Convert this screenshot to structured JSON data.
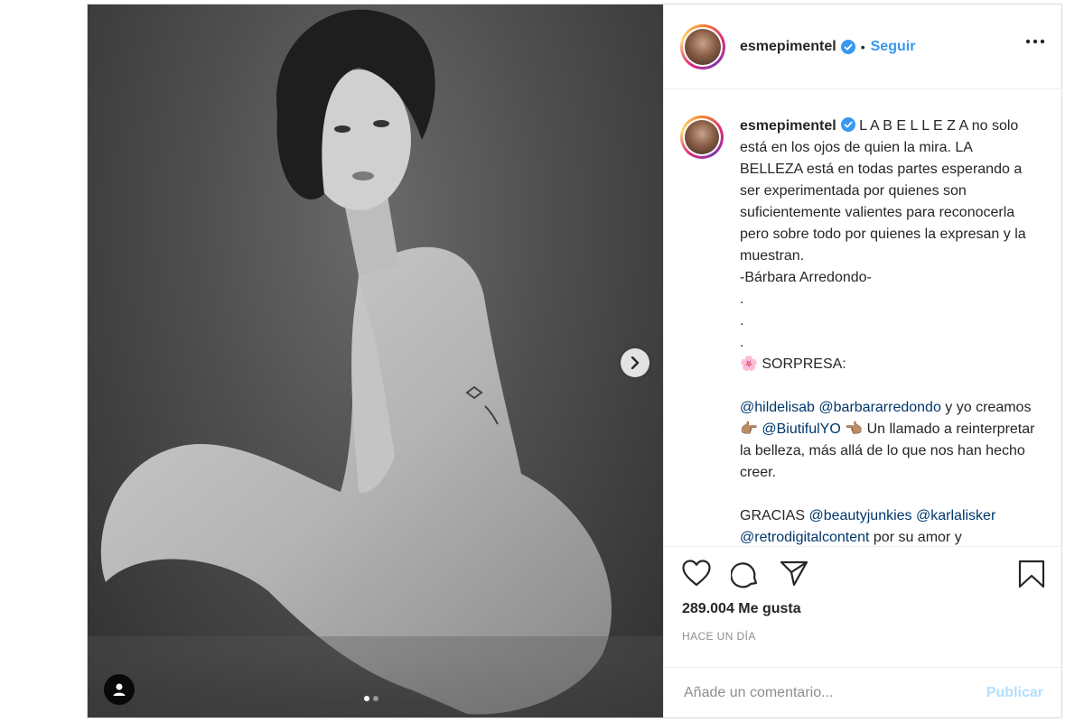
{
  "post": {
    "username": "esmepimentel",
    "follow_label": "Seguir",
    "separator": "•",
    "caption": {
      "line1": "L A B E L L E Z A no solo está en los ojos de quien la mira. LA BELLEZA está en todas partes esperando a ser experimentada por quienes son suficientemente valientes para reconocerla pero sobre todo por quienes la expresan y la muestran.",
      "author": "-Bárbara Arredondo-",
      "dot": ".",
      "surprise_emoji": "🌸",
      "surprise_label": "SORPRESA:",
      "mention1": "@hildelisab",
      "mention2": "@barbararredondo",
      "text_and_we": "y yo creamos",
      "point_right": "👉🏽",
      "mention3": "@BiutifulYO",
      "point_left": "👈🏽",
      "text_call": "Un llamado a reinterpretar la belleza, más allá de lo que nos han hecho creer.",
      "thanks": "GRACIAS",
      "mention4": "@beautyjunkies",
      "mention5": "@karlalisker",
      "mention6": "@retrodigitalcontent",
      "text_tail": "por su amor y"
    },
    "likes_label": "289.004 Me gusta",
    "time_label": "HACE UN DÍA",
    "comment_placeholder": "Añade un comentario...",
    "publish_label": "Publicar",
    "carousel": {
      "total": 2,
      "active": 1
    }
  },
  "icons": {
    "verified": "verified-badge-icon",
    "more": "more-options-icon",
    "like": "heart-icon",
    "comment": "comment-icon",
    "share": "share-icon",
    "save": "bookmark-icon",
    "next": "chevron-right-icon",
    "tag": "user-tag-icon"
  },
  "colors": {
    "accent": "#3897f0",
    "mention": "#00376b",
    "muted": "#8e8e8e",
    "publish_disabled": "#b2dffc"
  }
}
